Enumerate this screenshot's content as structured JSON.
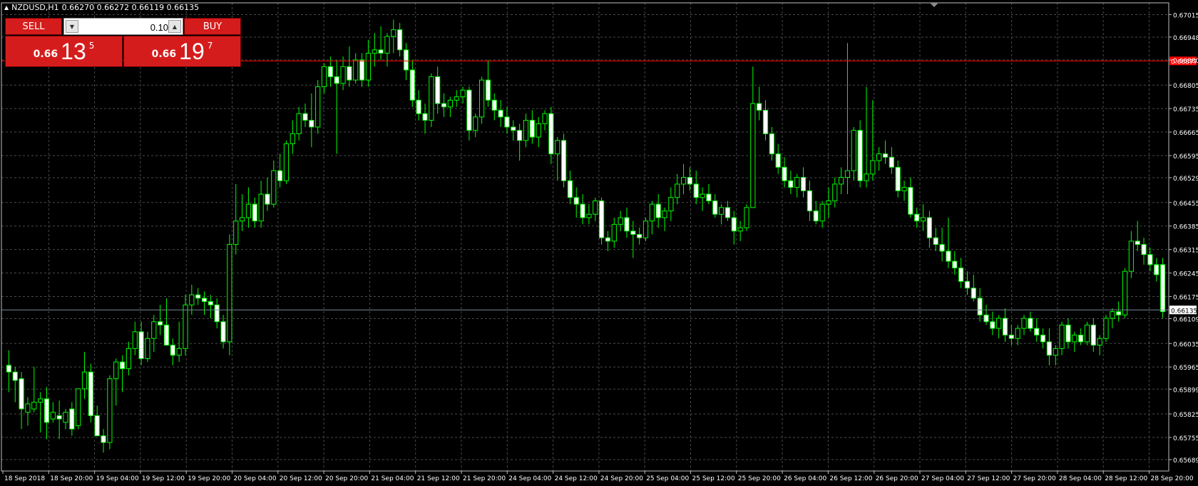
{
  "header": {
    "symbol": "NZDUSD,H1",
    "ohlc": "0.66270 0.66272 0.66119 0.66135"
  },
  "trade_panel": {
    "sell_label": "SELL",
    "buy_label": "BUY",
    "lot_value": "0.10",
    "sell_price": {
      "prefix": "0.66",
      "big": "13",
      "pip": "5"
    },
    "buy_price": {
      "prefix": "0.66",
      "big": "19",
      "pip": "7"
    }
  },
  "colors": {
    "background": "#000000",
    "grid": "#4a4a4a",
    "candle": "#00ff00",
    "bull_body": "#000000",
    "bear_body": "#ffffff",
    "ask_line": "#ff0000",
    "bid_line": "#778899",
    "button": "#d51c1c"
  },
  "chart_data": {
    "type": "candlestick",
    "symbol": "NZDUSD",
    "timeframe": "H1",
    "ylim": [
      0.65655,
      0.6705
    ],
    "y_ticks": [
      "0.67015",
      "0.66948",
      "0.66880",
      "0.66805",
      "0.66735",
      "0.66665",
      "0.66595",
      "0.66529",
      "0.66455",
      "0.66385",
      "0.66315",
      "0.66245",
      "0.66175",
      "0.66109",
      "0.66035",
      "0.65965",
      "0.65899",
      "0.65825",
      "0.65755",
      "0.65689"
    ],
    "x_ticks": [
      "18 Sep 2018",
      "18 Sep 20:00",
      "19 Sep 04:00",
      "19 Sep 12:00",
      "19 Sep 20:00",
      "20 Sep 04:00",
      "20 Sep 12:00",
      "20 Sep 20:00",
      "21 Sep 04:00",
      "21 Sep 12:00",
      "21 Sep 20:00",
      "24 Sep 04:00",
      "24 Sep 12:00",
      "24 Sep 20:00",
      "25 Sep 04:00",
      "25 Sep 12:00",
      "25 Sep 20:00",
      "26 Sep 04:00",
      "26 Sep 12:00",
      "26 Sep 20:00",
      "27 Sep 04:00",
      "27 Sep 12:00",
      "27 Sep 20:00",
      "28 Sep 04:00",
      "28 Sep 12:00",
      "28 Sep 20:00"
    ],
    "ask_price": 0.66877,
    "bid_price": 0.66135,
    "ask_label": "0.66877",
    "bid_label": "0.66135",
    "grid": true,
    "candles": [
      [
        0.6597,
        0.66015,
        0.6589,
        0.6595
      ],
      [
        0.6595,
        0.65965,
        0.6586,
        0.65925
      ],
      [
        0.6593,
        0.6595,
        0.6578,
        0.6584
      ],
      [
        0.6583,
        0.65875,
        0.6579,
        0.65855
      ],
      [
        0.6584,
        0.65965,
        0.6583,
        0.6586
      ],
      [
        0.6586,
        0.6589,
        0.6577,
        0.6587
      ],
      [
        0.6587,
        0.65905,
        0.6575,
        0.658
      ],
      [
        0.6581,
        0.6586,
        0.658,
        0.6583
      ],
      [
        0.6582,
        0.65865,
        0.6575,
        0.6581
      ],
      [
        0.658,
        0.6584,
        0.6578,
        0.6583
      ],
      [
        0.6584,
        0.6586,
        0.6576,
        0.6578
      ],
      [
        0.6579,
        0.659,
        0.6578,
        0.659
      ],
      [
        0.659,
        0.6601,
        0.6587,
        0.6595
      ],
      [
        0.6595,
        0.65975,
        0.658,
        0.6582
      ],
      [
        0.6582,
        0.6585,
        0.6576,
        0.6576
      ],
      [
        0.6576,
        0.6578,
        0.6571,
        0.6574
      ],
      [
        0.6574,
        0.6594,
        0.6572,
        0.6593
      ],
      [
        0.6593,
        0.6599,
        0.6585,
        0.6598
      ],
      [
        0.6598,
        0.66,
        0.6589,
        0.6596
      ],
      [
        0.6596,
        0.6604,
        0.6594,
        0.6602
      ],
      [
        0.6602,
        0.661,
        0.66,
        0.6607
      ],
      [
        0.6607,
        0.661,
        0.6597,
        0.6599
      ],
      [
        0.6599,
        0.6607,
        0.6598,
        0.6605
      ],
      [
        0.6605,
        0.6612,
        0.6601,
        0.661
      ],
      [
        0.661,
        0.6615,
        0.6606,
        0.6609
      ],
      [
        0.6609,
        0.6617,
        0.6603,
        0.6603
      ],
      [
        0.6603,
        0.6605,
        0.6597,
        0.66
      ],
      [
        0.66,
        0.661,
        0.6598,
        0.6602
      ],
      [
        0.6602,
        0.6618,
        0.66,
        0.6615
      ],
      [
        0.6615,
        0.6621,
        0.6612,
        0.6618
      ],
      [
        0.6618,
        0.662,
        0.6615,
        0.6617
      ],
      [
        0.6617,
        0.6619,
        0.6612,
        0.6616
      ],
      [
        0.6616,
        0.6618,
        0.6611,
        0.6615
      ],
      [
        0.6615,
        0.6617,
        0.6608,
        0.661
      ],
      [
        0.661,
        0.6612,
        0.6602,
        0.6604
      ],
      [
        0.6604,
        0.6636,
        0.66,
        0.6633
      ],
      [
        0.6633,
        0.6651,
        0.663,
        0.664
      ],
      [
        0.664,
        0.6648,
        0.6637,
        0.6641
      ],
      [
        0.6641,
        0.665,
        0.6638,
        0.6645
      ],
      [
        0.6645,
        0.6647,
        0.6638,
        0.664
      ],
      [
        0.664,
        0.6652,
        0.6638,
        0.6648
      ],
      [
        0.6648,
        0.6653,
        0.6643,
        0.6645
      ],
      [
        0.6645,
        0.6658,
        0.6644,
        0.6655
      ],
      [
        0.6655,
        0.666,
        0.665,
        0.6652
      ],
      [
        0.6652,
        0.6664,
        0.6651,
        0.6663
      ],
      [
        0.6663,
        0.667,
        0.666,
        0.6666
      ],
      [
        0.6666,
        0.6674,
        0.6664,
        0.6672
      ],
      [
        0.6672,
        0.6675,
        0.6668,
        0.667
      ],
      [
        0.667,
        0.6678,
        0.6662,
        0.6668
      ],
      [
        0.6668,
        0.6682,
        0.6666,
        0.668
      ],
      [
        0.668,
        0.6687,
        0.6678,
        0.6686
      ],
      [
        0.6686,
        0.6689,
        0.668,
        0.6683
      ],
      [
        0.6683,
        0.6688,
        0.666,
        0.6681
      ],
      [
        0.6681,
        0.6689,
        0.6679,
        0.6686
      ],
      [
        0.6686,
        0.6692,
        0.668,
        0.6682
      ],
      [
        0.6682,
        0.669,
        0.6681,
        0.6688
      ],
      [
        0.6688,
        0.669,
        0.668,
        0.6682
      ],
      [
        0.6682,
        0.6694,
        0.668,
        0.669
      ],
      [
        0.669,
        0.6696,
        0.6686,
        0.6691
      ],
      [
        0.6691,
        0.6698,
        0.6688,
        0.669
      ],
      [
        0.669,
        0.6696,
        0.6686,
        0.6695
      ],
      [
        0.6695,
        0.67,
        0.669,
        0.6697
      ],
      [
        0.6697,
        0.6699,
        0.6689,
        0.6691
      ],
      [
        0.6691,
        0.6693,
        0.6682,
        0.6685
      ],
      [
        0.6685,
        0.6688,
        0.6674,
        0.6676
      ],
      [
        0.6676,
        0.6679,
        0.667,
        0.6672
      ],
      [
        0.6672,
        0.6675,
        0.6666,
        0.667
      ],
      [
        0.667,
        0.6684,
        0.6668,
        0.6683
      ],
      [
        0.6683,
        0.6686,
        0.6672,
        0.6675
      ],
      [
        0.6675,
        0.6678,
        0.6671,
        0.6674
      ],
      [
        0.6674,
        0.6677,
        0.6671,
        0.6676
      ],
      [
        0.6676,
        0.6679,
        0.6674,
        0.6677
      ],
      [
        0.6677,
        0.668,
        0.6675,
        0.6679
      ],
      [
        0.6679,
        0.668,
        0.6664,
        0.6667
      ],
      [
        0.6667,
        0.6672,
        0.6665,
        0.6671
      ],
      [
        0.6671,
        0.6683,
        0.6669,
        0.6682
      ],
      [
        0.6682,
        0.6688,
        0.6674,
        0.6676
      ],
      [
        0.6676,
        0.6678,
        0.667,
        0.6673
      ],
      [
        0.6673,
        0.6676,
        0.6668,
        0.6671
      ],
      [
        0.6671,
        0.6674,
        0.6666,
        0.6668
      ],
      [
        0.6668,
        0.667,
        0.6664,
        0.6667
      ],
      [
        0.6667,
        0.6669,
        0.6658,
        0.6664
      ],
      [
        0.6664,
        0.6672,
        0.6662,
        0.667
      ],
      [
        0.667,
        0.6673,
        0.6663,
        0.6665
      ],
      [
        0.6665,
        0.6671,
        0.6662,
        0.6669
      ],
      [
        0.6669,
        0.6673,
        0.6667,
        0.6672
      ],
      [
        0.6672,
        0.6674,
        0.6657,
        0.666
      ],
      [
        0.666,
        0.6665,
        0.6652,
        0.6664
      ],
      [
        0.6664,
        0.6666,
        0.665,
        0.6652
      ],
      [
        0.6652,
        0.6655,
        0.6645,
        0.6647
      ],
      [
        0.6647,
        0.665,
        0.6641,
        0.6645
      ],
      [
        0.6645,
        0.6648,
        0.6639,
        0.6641
      ],
      [
        0.6641,
        0.6645,
        0.6639,
        0.6642
      ],
      [
        0.6642,
        0.6647,
        0.664,
        0.6646
      ],
      [
        0.6646,
        0.6647,
        0.6633,
        0.6635
      ],
      [
        0.6635,
        0.6637,
        0.6631,
        0.6634
      ],
      [
        0.6634,
        0.6641,
        0.6632,
        0.6639
      ],
      [
        0.6639,
        0.6643,
        0.6637,
        0.6641
      ],
      [
        0.6641,
        0.6644,
        0.6635,
        0.6637
      ],
      [
        0.6637,
        0.664,
        0.6629,
        0.6636
      ],
      [
        0.6636,
        0.6638,
        0.6633,
        0.6635
      ],
      [
        0.6635,
        0.6641,
        0.6634,
        0.664
      ],
      [
        0.664,
        0.6646,
        0.6636,
        0.6645
      ],
      [
        0.6645,
        0.6648,
        0.6638,
        0.6641
      ],
      [
        0.6641,
        0.6644,
        0.6637,
        0.6643
      ],
      [
        0.6643,
        0.665,
        0.664,
        0.6647
      ],
      [
        0.6647,
        0.6654,
        0.6645,
        0.6651
      ],
      [
        0.6651,
        0.6657,
        0.6648,
        0.6653
      ],
      [
        0.6653,
        0.6656,
        0.6649,
        0.6651
      ],
      [
        0.6651,
        0.6655,
        0.6645,
        0.6647
      ],
      [
        0.6647,
        0.665,
        0.6643,
        0.6648
      ],
      [
        0.6648,
        0.6651,
        0.6645,
        0.6646
      ],
      [
        0.6646,
        0.6648,
        0.6641,
        0.6642
      ],
      [
        0.6642,
        0.6645,
        0.6639,
        0.6644
      ],
      [
        0.6644,
        0.6646,
        0.664,
        0.6641
      ],
      [
        0.6641,
        0.6643,
        0.6633,
        0.6637
      ],
      [
        0.6637,
        0.664,
        0.6634,
        0.6638
      ],
      [
        0.6638,
        0.6645,
        0.6637,
        0.6644
      ],
      [
        0.6644,
        0.6686,
        0.6652,
        0.6675
      ],
      [
        0.6675,
        0.668,
        0.667,
        0.6673
      ],
      [
        0.6673,
        0.6676,
        0.6664,
        0.6666
      ],
      [
        0.6666,
        0.6668,
        0.6658,
        0.666
      ],
      [
        0.666,
        0.6663,
        0.6654,
        0.6656
      ],
      [
        0.6656,
        0.6659,
        0.665,
        0.6652
      ],
      [
        0.6652,
        0.6655,
        0.6648,
        0.665
      ],
      [
        0.665,
        0.6654,
        0.6647,
        0.6653
      ],
      [
        0.6653,
        0.6656,
        0.6647,
        0.6649
      ],
      [
        0.6649,
        0.6652,
        0.664,
        0.6643
      ],
      [
        0.6643,
        0.6646,
        0.6639,
        0.664
      ],
      [
        0.664,
        0.6646,
        0.6638,
        0.6645
      ],
      [
        0.6645,
        0.665,
        0.6641,
        0.6646
      ],
      [
        0.6646,
        0.6653,
        0.6644,
        0.6651
      ],
      [
        0.6651,
        0.6656,
        0.6648,
        0.6653
      ],
      [
        0.6653,
        0.6693,
        0.6648,
        0.6655
      ],
      [
        0.6655,
        0.6668,
        0.6652,
        0.6667
      ],
      [
        0.6667,
        0.667,
        0.665,
        0.6652
      ],
      [
        0.6652,
        0.668,
        0.665,
        0.6654
      ],
      [
        0.6654,
        0.6676,
        0.6652,
        0.6658
      ],
      [
        0.6658,
        0.6662,
        0.6655,
        0.666
      ],
      [
        0.666,
        0.6664,
        0.6657,
        0.6659
      ],
      [
        0.6659,
        0.6662,
        0.6654,
        0.6656
      ],
      [
        0.6656,
        0.6658,
        0.6647,
        0.6649
      ],
      [
        0.6649,
        0.6652,
        0.6646,
        0.665
      ],
      [
        0.665,
        0.6653,
        0.6641,
        0.6642
      ],
      [
        0.6642,
        0.6644,
        0.6638,
        0.664
      ],
      [
        0.664,
        0.6645,
        0.6637,
        0.6641
      ],
      [
        0.6641,
        0.6643,
        0.6632,
        0.6635
      ],
      [
        0.6635,
        0.6638,
        0.6631,
        0.6633
      ],
      [
        0.6633,
        0.6638,
        0.6628,
        0.6631
      ],
      [
        0.6631,
        0.6641,
        0.6626,
        0.6628
      ],
      [
        0.6628,
        0.6631,
        0.6624,
        0.6626
      ],
      [
        0.6626,
        0.6629,
        0.662,
        0.6622
      ],
      [
        0.6622,
        0.6625,
        0.6618,
        0.662
      ],
      [
        0.662,
        0.6624,
        0.6616,
        0.6617
      ],
      [
        0.6617,
        0.662,
        0.661,
        0.6612
      ],
      [
        0.6612,
        0.6615,
        0.6609,
        0.661
      ],
      [
        0.661,
        0.6613,
        0.6606,
        0.6608
      ],
      [
        0.6608,
        0.6612,
        0.6605,
        0.6611
      ],
      [
        0.6611,
        0.6614,
        0.6604,
        0.6606
      ],
      [
        0.6606,
        0.6609,
        0.6603,
        0.6605
      ],
      [
        0.6605,
        0.6609,
        0.6603,
        0.6608
      ],
      [
        0.6608,
        0.6612,
        0.6606,
        0.6611
      ],
      [
        0.6611,
        0.6613,
        0.6607,
        0.6608
      ],
      [
        0.6608,
        0.6611,
        0.6604,
        0.6606
      ],
      [
        0.6606,
        0.6608,
        0.6602,
        0.6604
      ],
      [
        0.6604,
        0.6608,
        0.6597,
        0.66
      ],
      [
        0.66,
        0.6603,
        0.6597,
        0.6602
      ],
      [
        0.6602,
        0.661,
        0.66,
        0.6609
      ],
      [
        0.6609,
        0.6611,
        0.6602,
        0.6604
      ],
      [
        0.6604,
        0.6607,
        0.6601,
        0.6606
      ],
      [
        0.6606,
        0.6608,
        0.6603,
        0.6604
      ],
      [
        0.6604,
        0.661,
        0.6603,
        0.6609
      ],
      [
        0.6609,
        0.6611,
        0.6601,
        0.6603
      ],
      [
        0.6603,
        0.6606,
        0.66,
        0.6605
      ],
      [
        0.6605,
        0.6612,
        0.6604,
        0.6611
      ],
      [
        0.6611,
        0.6614,
        0.6608,
        0.6613
      ],
      [
        0.6613,
        0.6616,
        0.661,
        0.6612
      ],
      [
        0.6612,
        0.6626,
        0.6611,
        0.6625
      ],
      [
        0.6625,
        0.6637,
        0.6623,
        0.6634
      ],
      [
        0.6634,
        0.664,
        0.6631,
        0.6633
      ],
      [
        0.6633,
        0.6635,
        0.6627,
        0.663
      ],
      [
        0.663,
        0.6632,
        0.6625,
        0.6627
      ],
      [
        0.6627,
        0.6629,
        0.6622,
        0.6624
      ],
      [
        0.6627,
        0.6629,
        0.6611,
        0.6613
      ]
    ]
  }
}
